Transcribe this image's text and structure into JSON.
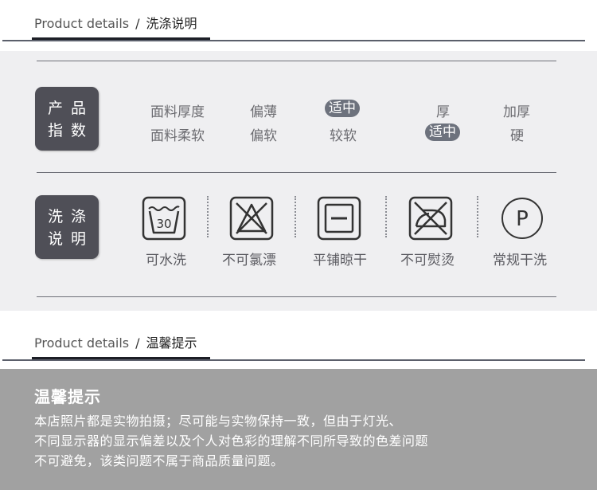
{
  "header1": {
    "en": "Product details",
    "slash": "/",
    "cn": "洗涤说明"
  },
  "index_badge": {
    "line1": "产品",
    "line2": "指数"
  },
  "thickness": {
    "label": "面料厚度",
    "options": [
      "偏薄",
      "适中",
      "厚",
      "加厚"
    ],
    "selected": "适中"
  },
  "softness": {
    "label": "面料柔软",
    "options": [
      "偏软",
      "较软",
      "适中",
      "硬"
    ],
    "selected": "适中"
  },
  "wash_badge": {
    "line1": "洗涤",
    "line2": "说明"
  },
  "care_items": [
    {
      "icon": "hand-wash-30-icon",
      "label": "可水洗",
      "temp": "30"
    },
    {
      "icon": "no-bleach-icon",
      "label": "不可氯漂"
    },
    {
      "icon": "dry-flat-icon",
      "label": "平铺晾干"
    },
    {
      "icon": "no-iron-icon",
      "label": "不可熨烫"
    },
    {
      "icon": "dry-clean-p-icon",
      "label": "常规干洗",
      "letter": "P"
    }
  ],
  "header2": {
    "en": "Product details",
    "slash": "/",
    "cn": "温馨提示"
  },
  "tips": {
    "title": "温馨提示",
    "lines": [
      "本店照片都是实物拍摄；尽可能与实物保持一致，但由于灯光、",
      "不同显示器的显示偏差以及个人对色彩的理解不同所导致的色差问题",
      "不可避免，该类问题不属于商品质量问题。"
    ]
  }
}
